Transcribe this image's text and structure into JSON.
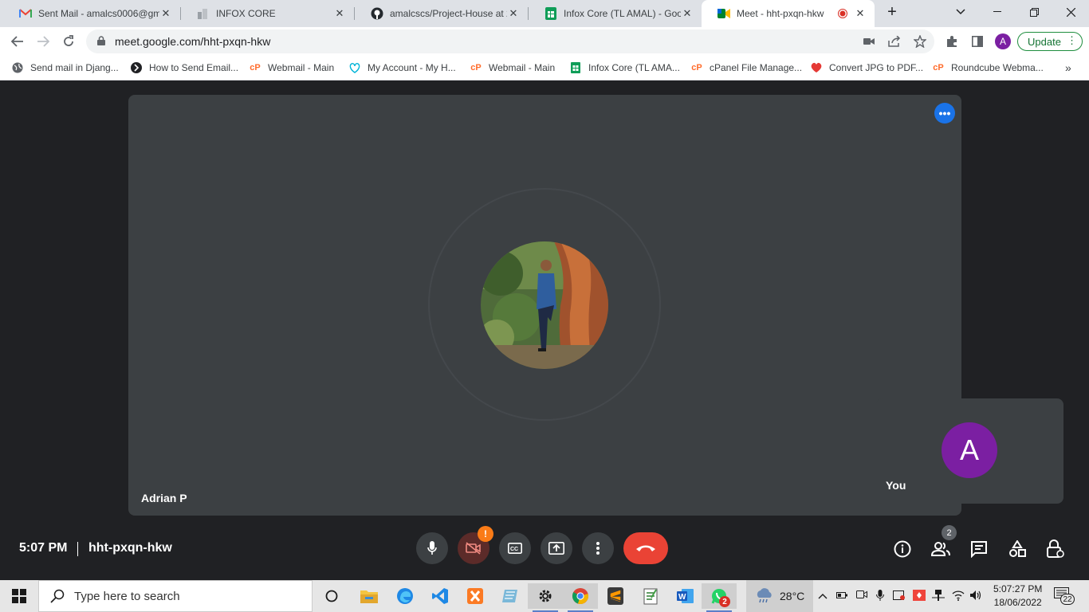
{
  "browser": {
    "tabs": [
      {
        "title": "Sent Mail - amalcs0006@gm",
        "favicon": "gmail-icon",
        "active": false
      },
      {
        "title": "INFOX CORE",
        "favicon": "page-icon",
        "active": false
      },
      {
        "title": "amalcscs/Project-House at 2(",
        "favicon": "github-icon",
        "active": false
      },
      {
        "title": "Infox Core (TL AMAL) - Goog",
        "favicon": "sheets-icon",
        "active": false
      },
      {
        "title": "Meet - hht-pxqn-hkw",
        "favicon": "meet-icon",
        "active": true
      }
    ],
    "url": "meet.google.com/hht-pxqn-hkw",
    "profile_initial": "A",
    "update_label": "Update",
    "bookmarks": [
      {
        "label": "Send mail in Djang...",
        "icon": "globe-icon"
      },
      {
        "label": "How to Send Email...",
        "icon": "site-icon"
      },
      {
        "label": "Webmail - Main",
        "icon": "cpanel-icon"
      },
      {
        "label": "My Account - My H...",
        "icon": "hostinger-icon"
      },
      {
        "label": "Webmail - Main",
        "icon": "cpanel-icon"
      },
      {
        "label": "Infox Core (TL AMA...",
        "icon": "sheets-icon"
      },
      {
        "label": "cPanel File Manage...",
        "icon": "cpanel-icon"
      },
      {
        "label": "Convert JPG to PDF...",
        "icon": "heart-icon"
      },
      {
        "label": "Roundcube Webma...",
        "icon": "cpanel-icon"
      }
    ]
  },
  "meet": {
    "participant_name": "Adrian P",
    "self_name": "You",
    "self_initial": "A",
    "time": "5:07 PM",
    "meeting_code": "hht-pxqn-hkw",
    "people_count": "2",
    "camera_warning": "!"
  },
  "taskbar": {
    "search_placeholder": "Type here to search",
    "weather": "28°C",
    "clock_time": "5:07:27 PM",
    "clock_date": "18/06/2022",
    "notifications": "22",
    "whatsapp_badge": "2"
  },
  "colors": {
    "meet_bg": "#202124",
    "tile_bg": "#3c4043",
    "hangup_red": "#ea4335",
    "self_avatar": "#7b1fa2",
    "accent_blue": "#1a73e8"
  }
}
